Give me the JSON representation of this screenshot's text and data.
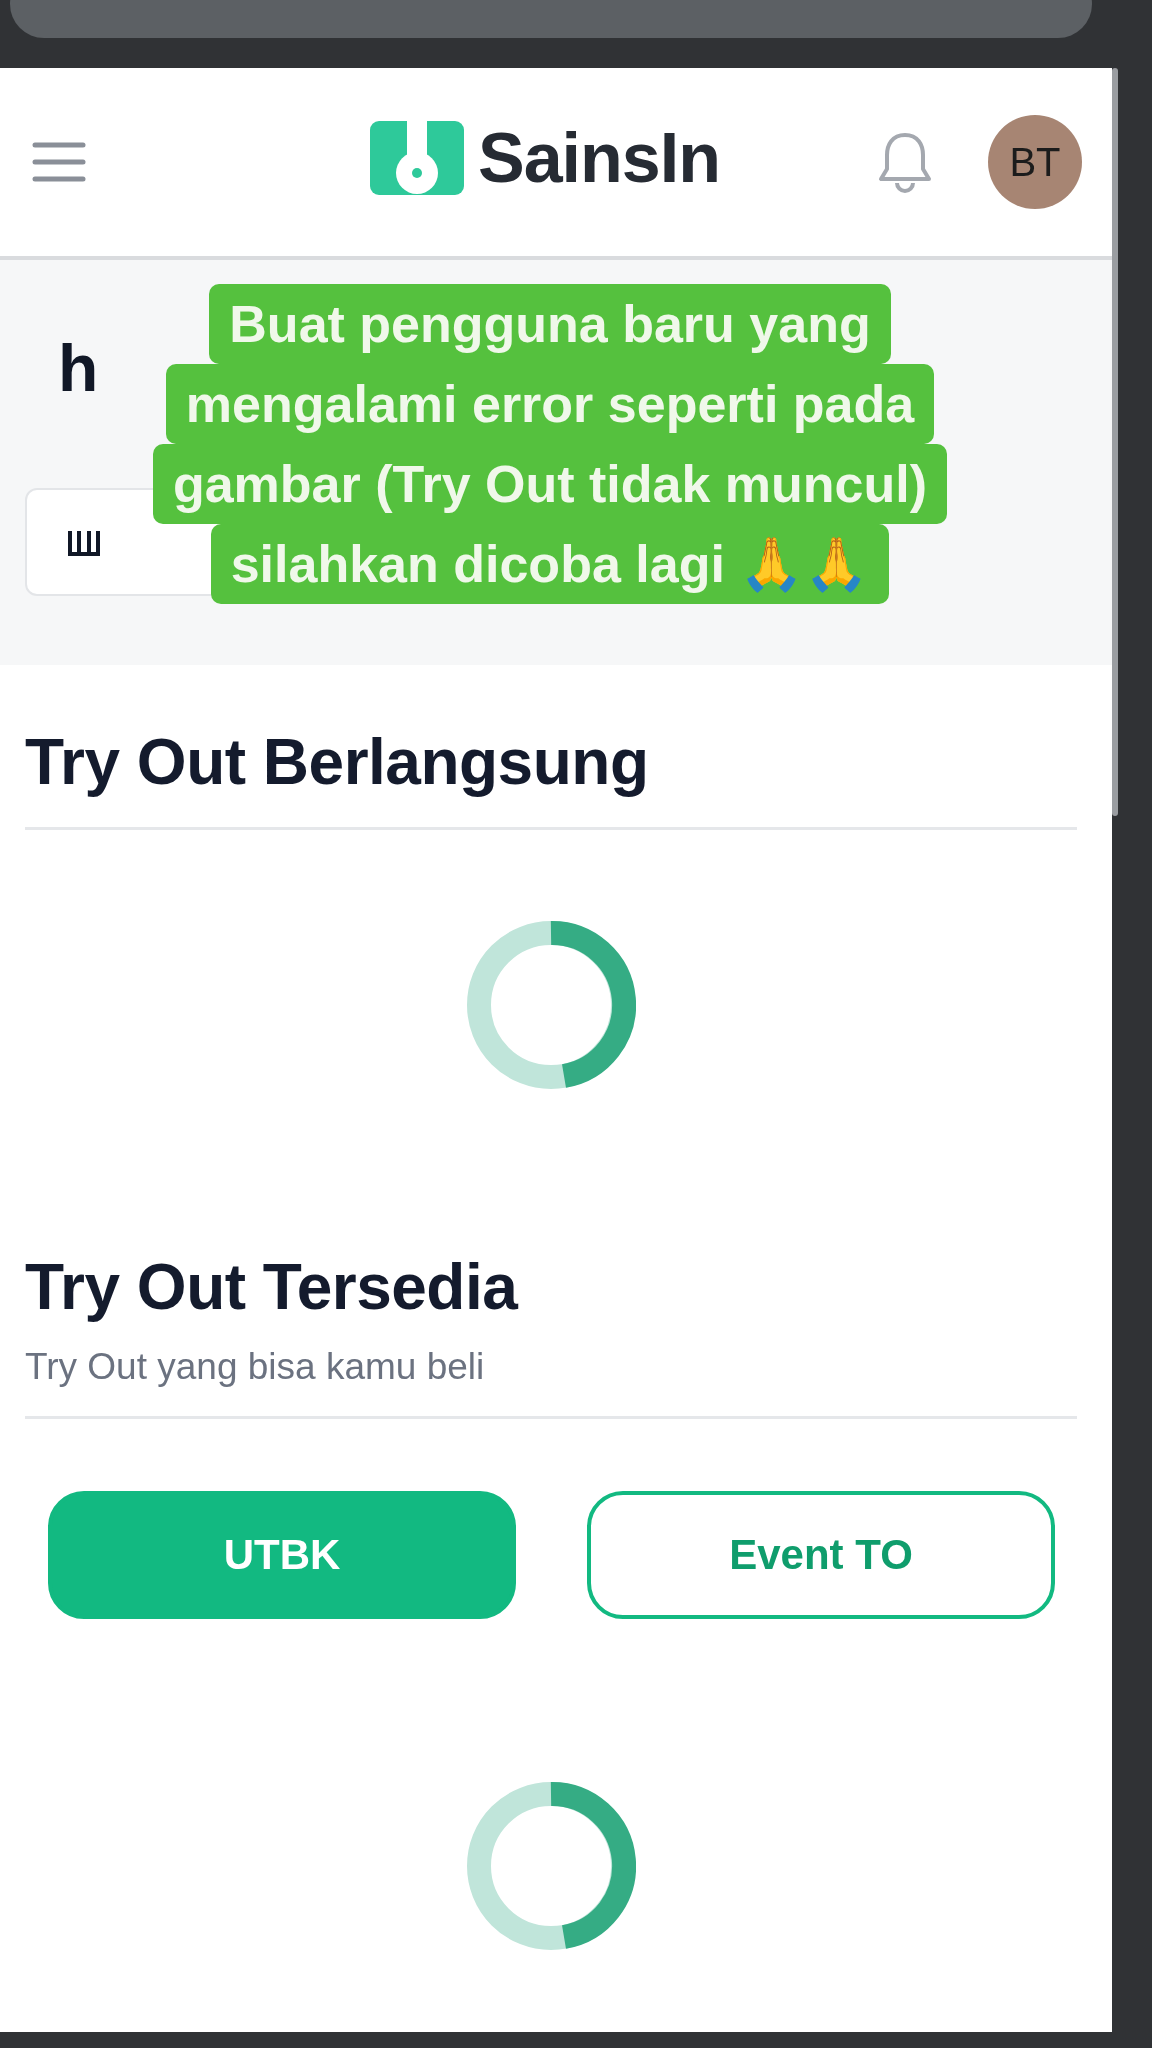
{
  "header": {
    "logo": "SainsIn",
    "avatar": "BT"
  },
  "greeting": {
    "text": "h"
  },
  "caption": {
    "lines": [
      "Buat pengguna baru yang",
      "mengalami error seperti pada",
      "gambar (Try Out tidak muncul)",
      "silahkan dicoba lagi 🙏🙏"
    ]
  },
  "ongoing": {
    "title": "Try Out Berlangsung"
  },
  "available": {
    "title": "Try Out Tersedia",
    "subtitle": "Try Out yang bisa kamu beli",
    "tabs": [
      {
        "label": "UTBK",
        "selected": true
      },
      {
        "label": "Event TO",
        "selected": false
      }
    ]
  }
}
